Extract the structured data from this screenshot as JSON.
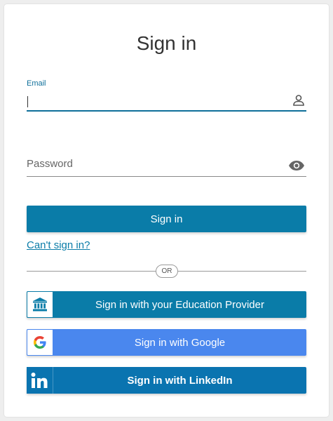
{
  "title": "Sign in",
  "email": {
    "label": "Email",
    "value": "",
    "icon": "user-icon"
  },
  "password": {
    "placeholder": "Password",
    "icon": "eye-icon"
  },
  "sign_in_button": "Sign in",
  "cant_sign_in": "Can't sign in?",
  "divider": "OR",
  "providers": [
    {
      "label": "Sign in with your Education Provider",
      "icon": "institution-icon",
      "color": "#0a7ca8"
    },
    {
      "label": "Sign in with Google",
      "icon": "google-icon",
      "color": "#4a87ee"
    },
    {
      "label": "Sign in with LinkedIn",
      "icon": "linkedin-icon",
      "color": "#0a74b0"
    }
  ],
  "colors": {
    "primary": "#0a7ca8",
    "google": "#4a87ee",
    "linkedin": "#0a74b0"
  }
}
